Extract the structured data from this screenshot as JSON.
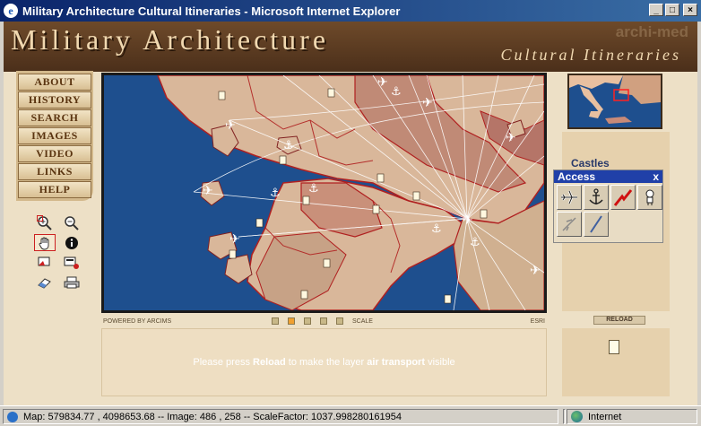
{
  "window": {
    "title": "Military Architecture Cultural Itineraries - Microsoft Internet Explorer",
    "controls": [
      "minimize",
      "maximize",
      "close"
    ]
  },
  "header": {
    "title": "Military Architecture",
    "subtitle": "Cultural Itineraries",
    "watermark": "archi-med"
  },
  "nav": {
    "items": [
      {
        "label": "ABOUT"
      },
      {
        "label": "HISTORY"
      },
      {
        "label": "SEARCH"
      },
      {
        "label": "IMAGES"
      },
      {
        "label": "VIDEO"
      },
      {
        "label": "LINKS"
      },
      {
        "label": "HELP"
      }
    ]
  },
  "tools": {
    "items": [
      {
        "name": "zoom-in-icon",
        "glyph": "⊕",
        "active": false
      },
      {
        "name": "zoom-out-icon",
        "glyph": "⊖",
        "active": false
      },
      {
        "name": "pan-hand-icon",
        "glyph": "✋",
        "active": true
      },
      {
        "name": "info-icon",
        "glyph": "ℹ",
        "active": false
      },
      {
        "name": "select-icon",
        "glyph": "▭",
        "active": false
      },
      {
        "name": "clear-selection-icon",
        "glyph": "⎘",
        "active": false
      },
      {
        "name": "eraser-icon",
        "glyph": "⌫",
        "active": false
      },
      {
        "name": "print-icon",
        "glyph": "⎙",
        "active": false
      }
    ]
  },
  "map": {
    "powered_by": "POWERED BY ARCIMS",
    "scale_label": "SCALE",
    "scale_selected": 1,
    "esri": "ESRI",
    "colors": {
      "sea": "#1e4f8e",
      "land_light": "#d9b79a",
      "land_dark": "#b77a6a",
      "roads": "#ffffff",
      "borders": "#b02020"
    }
  },
  "message": {
    "prefix": "Please press ",
    "reload": "Reload",
    "middle": " to make the layer ",
    "layer": "air transport",
    "suffix": " visible"
  },
  "right_panel": {
    "castles_label": "Castles",
    "access_title": "Access",
    "access_close": "x",
    "access_icons": [
      "airplane-icon",
      "anchor-icon",
      "railway-icon",
      "bus-stop-icon",
      "airport-disabled-icon",
      "road-icon"
    ],
    "reload_button": "RELOAD"
  },
  "statusbar": {
    "text": "Map: 579834.77 , 4098653.68 -- Image: 486 , 258 -- ScaleFactor: 1037.998280161954",
    "zone": "Internet"
  }
}
